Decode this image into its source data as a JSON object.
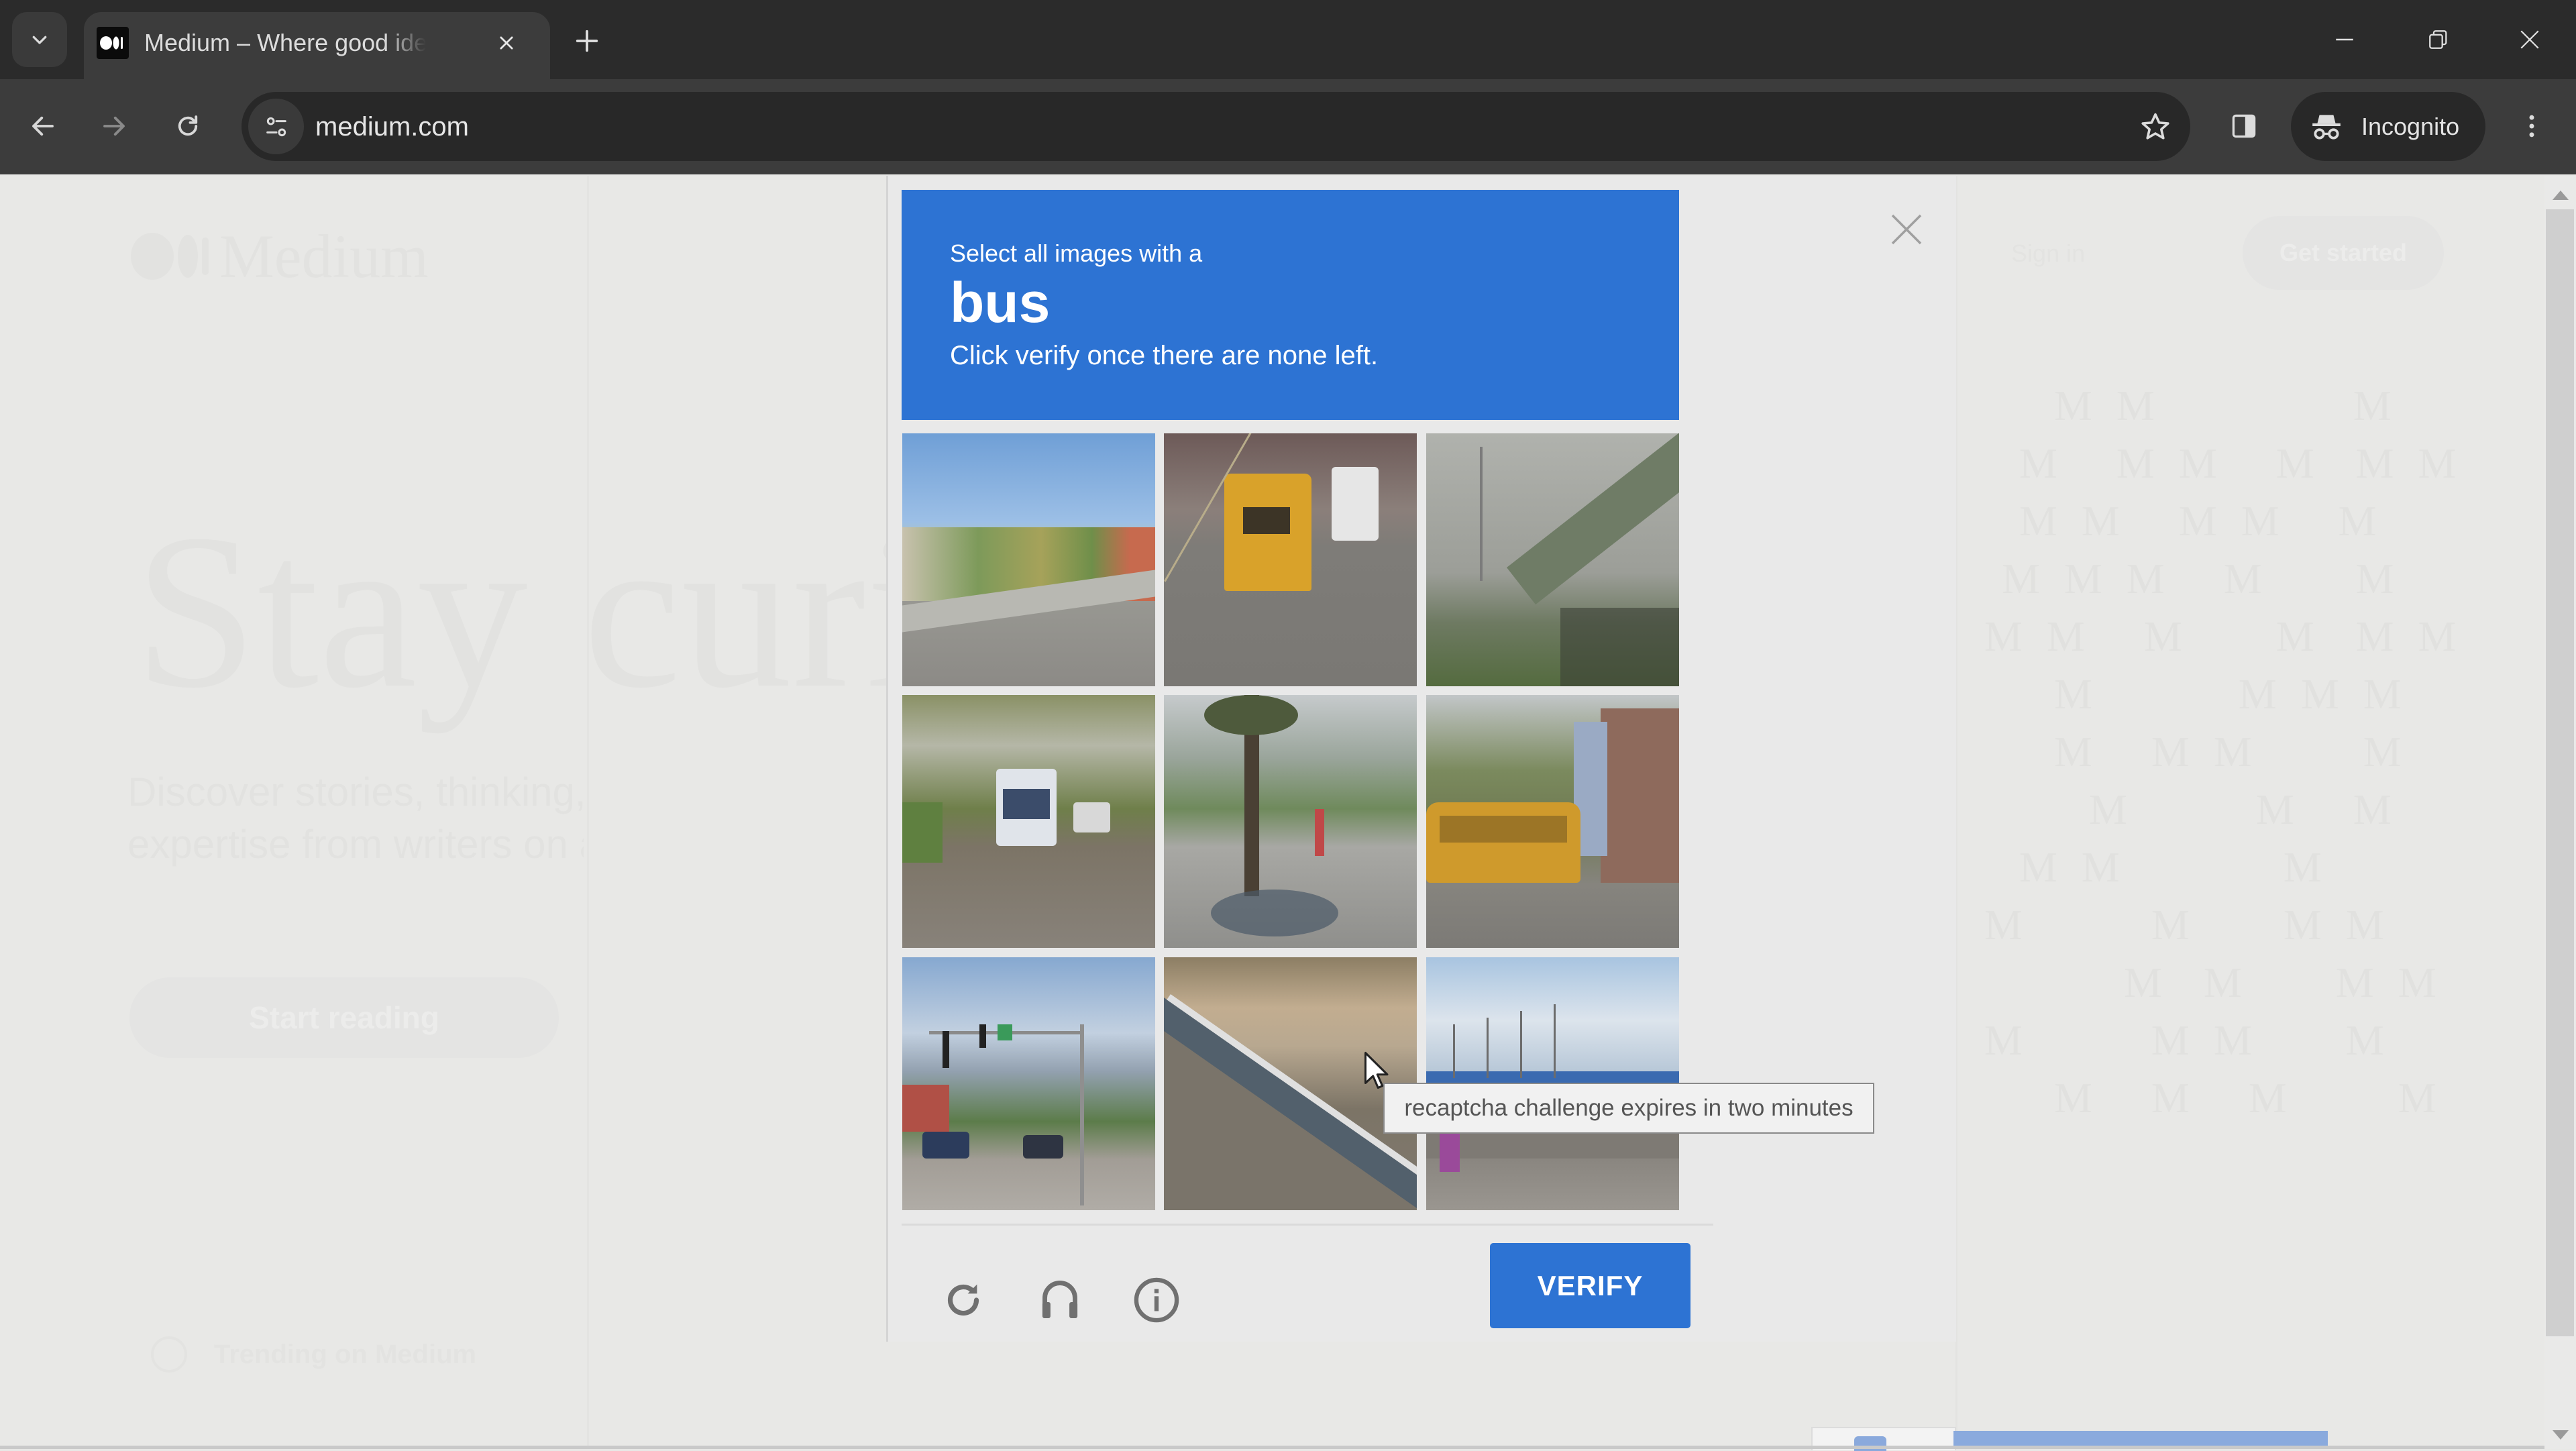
{
  "browser": {
    "tab": {
      "title": "Medium – Where good ideas find you",
      "favicon": "medium-logo-icon",
      "close_icon": "close-icon"
    },
    "new_tab_icon": "plus-icon",
    "tab_search_icon": "chevron-down-icon",
    "window_controls": [
      "minimize-icon",
      "restore-icon",
      "close-icon"
    ],
    "toolbar": {
      "back_icon": "arrow-left-icon",
      "forward_icon": "arrow-right-icon",
      "reload_icon": "reload-icon",
      "site_info_icon": "tune-icon",
      "url": "medium.com",
      "bookmark_icon": "star-icon",
      "side_panel_icon": "side-panel-icon",
      "incognito_label": "Incognito",
      "menu_icon": "kebab-menu-icon"
    }
  },
  "background_page": {
    "logo_text": "Medium",
    "hero_heading": "Stay curious.",
    "hero_subtitle_line1": "Discover stories, thinking, and",
    "hero_subtitle_line2": "expertise from writers on any topic.",
    "start_reading_label": "Start reading",
    "sign_in_label": "Sign in",
    "get_started_label": "Get started",
    "trending_label": "Trending on Medium",
    "m_pattern_rows": [
      "    M M           M",
      "  M   M M   M  M M",
      "  M M   M M   M",
      " M M M   M     M",
      "M M   M     M  M M",
      "    M        M M M",
      "    M   M M      M",
      "      M       M   M",
      "  M M         M",
      "M       M     M M",
      "        M  M     M M",
      "M       M M     M",
      "    M   M   M      M"
    ]
  },
  "recaptcha": {
    "prompt": "Select all images with a",
    "target": "bus",
    "instruction": "Click verify once there are none left.",
    "tiles": [
      {
        "index": 1,
        "scene": "suburban street with houses and trees"
      },
      {
        "index": 2,
        "scene": "yellow school bus on city street"
      },
      {
        "index": 3,
        "scene": "highway overpass bridge"
      },
      {
        "index": 4,
        "scene": "transit bus on tree-lined street"
      },
      {
        "index": 5,
        "scene": "palm tree and sidewalk"
      },
      {
        "index": 6,
        "scene": "yellow school bus near houses"
      },
      {
        "index": 7,
        "scene": "intersection with traffic lights"
      },
      {
        "index": 8,
        "scene": "highway guardrail"
      },
      {
        "index": 9,
        "scene": "building with flagpoles"
      }
    ],
    "reload_icon": "reload-icon",
    "audio_icon": "headphones-icon",
    "info_icon": "info-icon",
    "verify_label": "VERIFY",
    "close_icon": "close-icon",
    "tooltip": "recaptcha challenge expires in two minutes",
    "accent_color": "#2d73d3"
  }
}
